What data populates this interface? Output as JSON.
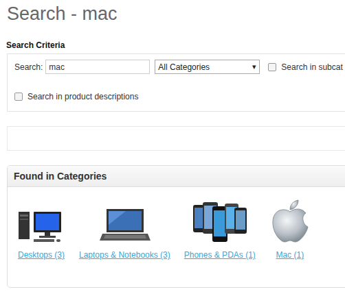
{
  "page": {
    "title": "Search - mac"
  },
  "criteria": {
    "heading": "Search Criteria",
    "search_label": "Search:",
    "search_value": "mac",
    "category": "All Categories",
    "dropdown_arrow": "▾",
    "options": [
      {
        "label": "Search in subcat",
        "checked": false
      },
      {
        "label": "Search in product descriptions",
        "checked": false
      }
    ]
  },
  "categories": {
    "heading": "Found in Categories",
    "items": [
      {
        "label": "Desktops (3)",
        "kind": "desktop"
      },
      {
        "label": "Laptops & Notebooks (3)",
        "kind": "laptop"
      },
      {
        "label": "Phones & PDAs (1)",
        "kind": "phones"
      },
      {
        "label": "Mac (1)",
        "kind": "apple"
      }
    ]
  }
}
